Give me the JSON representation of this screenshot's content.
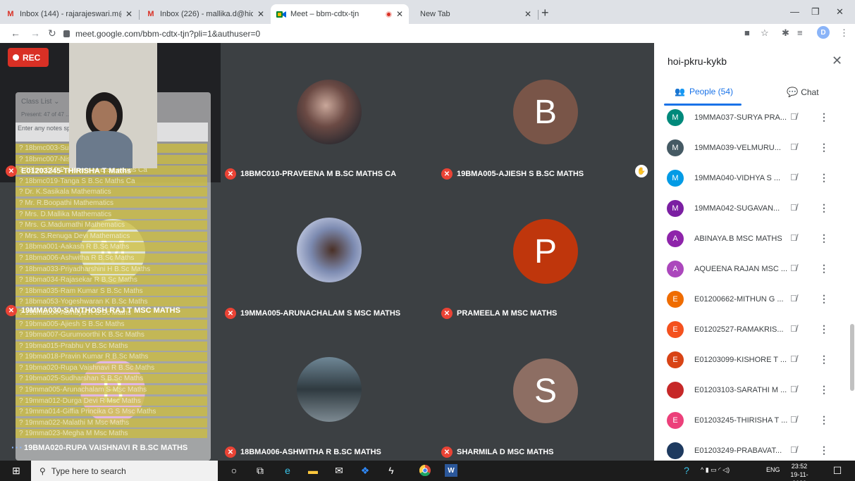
{
  "browser": {
    "tabs": [
      {
        "title": "Inbox (144) - rajarajeswari.m@hi",
        "icon": "gmail-icon"
      },
      {
        "title": "Inbox (226) - mallika.d@hicas.ac",
        "icon": "gmail-icon"
      },
      {
        "title": "Meet – bbm-cdtx-tjn",
        "icon": "meet-icon"
      },
      {
        "title": "New Tab",
        "icon": "none"
      }
    ],
    "url": "meet.google.com/bbm-cdtx-tjn?pli=1&authuser=0",
    "profile_initial": "D"
  },
  "meet": {
    "rec_label": "REC",
    "tiles": [
      {
        "name": "E01203245-THIRISHA T Maths",
        "avatar": ""
      },
      {
        "name": "18BMC010-PRAVEENA M B.SC MATHS CA",
        "avatar": ""
      },
      {
        "name": "19BMA005-AJIESH S B.SC MATHS",
        "avatar": "B",
        "avatar_color": "#795548"
      },
      {
        "name": "19MMA030-SANTHOSH RAJ T MSC MATHS",
        "avatar": "M",
        "avatar_color": "#bfcab0"
      },
      {
        "name": "19MMA005-ARUNACHALAM S MSC MATHS",
        "avatar": ""
      },
      {
        "name": "PRAMEELA M MSC MATHS",
        "avatar": "P",
        "avatar_color": "#bf360c"
      },
      {
        "name": "19BMA020-RUPA VAISHNAVI R B.SC MATHS",
        "avatar": "B",
        "avatar_color": "#c66bd1"
      },
      {
        "name": "18BMA006-ASHWITHA R B.SC MATHS",
        "avatar": ""
      },
      {
        "name": "SHARMILA D MSC MATHS",
        "avatar": "S",
        "avatar_color": "#8d6e63"
      }
    ],
    "class_list": {
      "title": "Class List",
      "stats": "Present: 47 of 47   ...   Start: 00:33   ✓ Duration: 89",
      "notes_placeholder": "Enter any notes specific to this class.",
      "rows": [
        "? 18bmc003-Surya Sri S B.Sc Maths Ca",
        "? 18bmc007-Nishanthini S B.Sc Maths Ca",
        "? 18bmc010-Praveena M B.Sc Maths Ca",
        "? 18bmc019-Tanga S B.Sc Maths Ca",
        "? Dr. K.Sasikala Mathematics",
        "? Mr. R.Boopathi Mathematics",
        "? Mrs. D.Mallika Mathematics",
        "? Mrs. G.Madumathi Mathematics",
        "? Mrs. S.Renuga Devi Mathematics",
        "? 18bma001-Aakash R B.Sc Maths",
        "? 18bma006-Ashwitha R B.Sc Maths",
        "? 18bma033-Priyadharshini H B.Sc Maths",
        "? 18bma034-Rajasekar R B.Sc Maths",
        "? 18bma035-Ram Kumar S B.Sc Maths",
        "? 18bma053-Yogeshwaran K B.Sc Maths",
        "? 19bma004-Abinaya R B.Sc Maths",
        "? 19bma005-Ajiesh S B.Sc Maths",
        "? 19bma007-Gurumoorthi K B.Sc Maths",
        "? 19bma015-Prabhu V B.Sc Maths",
        "? 19bma018-Pravin Kumar R B.Sc Maths",
        "? 19bma020-Rupa Vaishnavi R B.Sc Maths",
        "? 19bma025-Sudharshan S B.Sc Maths",
        "? 19mma005-Arunachalam S Msc Maths",
        "? 19mma012-Durga Devi R Msc Maths",
        "? 19mma014-Giffia Princika G S Msc Maths",
        "? 19mma022-Malathi M Msc Maths",
        "? 19mma023-Megha M Msc Maths"
      ]
    }
  },
  "panel": {
    "title": "hoi-pkru-kykb",
    "people_tab": "People (54)",
    "chat_tab": "Chat",
    "participants": [
      {
        "name": "19MMA037-SURYA PRA...",
        "initial": "M",
        "color": "#00897b"
      },
      {
        "name": "19MMA039-VELMURU...",
        "initial": "M",
        "color": "#455a64"
      },
      {
        "name": "19MMA040-VIDHYA S ...",
        "initial": "M",
        "color": "#039be5"
      },
      {
        "name": "19MMA042-SUGAVAN...",
        "initial": "M",
        "color": "#7b1fa2"
      },
      {
        "name": "ABINAYA.B MSC MATHS",
        "initial": "A",
        "color": "#8e24aa"
      },
      {
        "name": "AQUEENA RAJAN MSC ...",
        "initial": "A",
        "color": "#ab47bc"
      },
      {
        "name": "E01200662-MITHUN G ...",
        "initial": "E",
        "color": "#ef6c00"
      },
      {
        "name": "E01202527-RAMAKRIS...",
        "initial": "E",
        "color": "#f4511e"
      },
      {
        "name": "E01203099-KISHORE T ...",
        "initial": "E",
        "color": "#d84315"
      },
      {
        "name": "E01203103-SARATHI M ...",
        "initial": "",
        "color": "#c62828"
      },
      {
        "name": "E01203245-THIRISHA T ...",
        "initial": "E",
        "color": "#ec407a"
      },
      {
        "name": "E01203249-PRABAVAT...",
        "initial": "",
        "color": "#1e3a5f"
      }
    ]
  },
  "taskbar": {
    "search_placeholder": "Type here to search",
    "lang": "ENG",
    "time": "23:52",
    "date": "19-11-2020"
  }
}
